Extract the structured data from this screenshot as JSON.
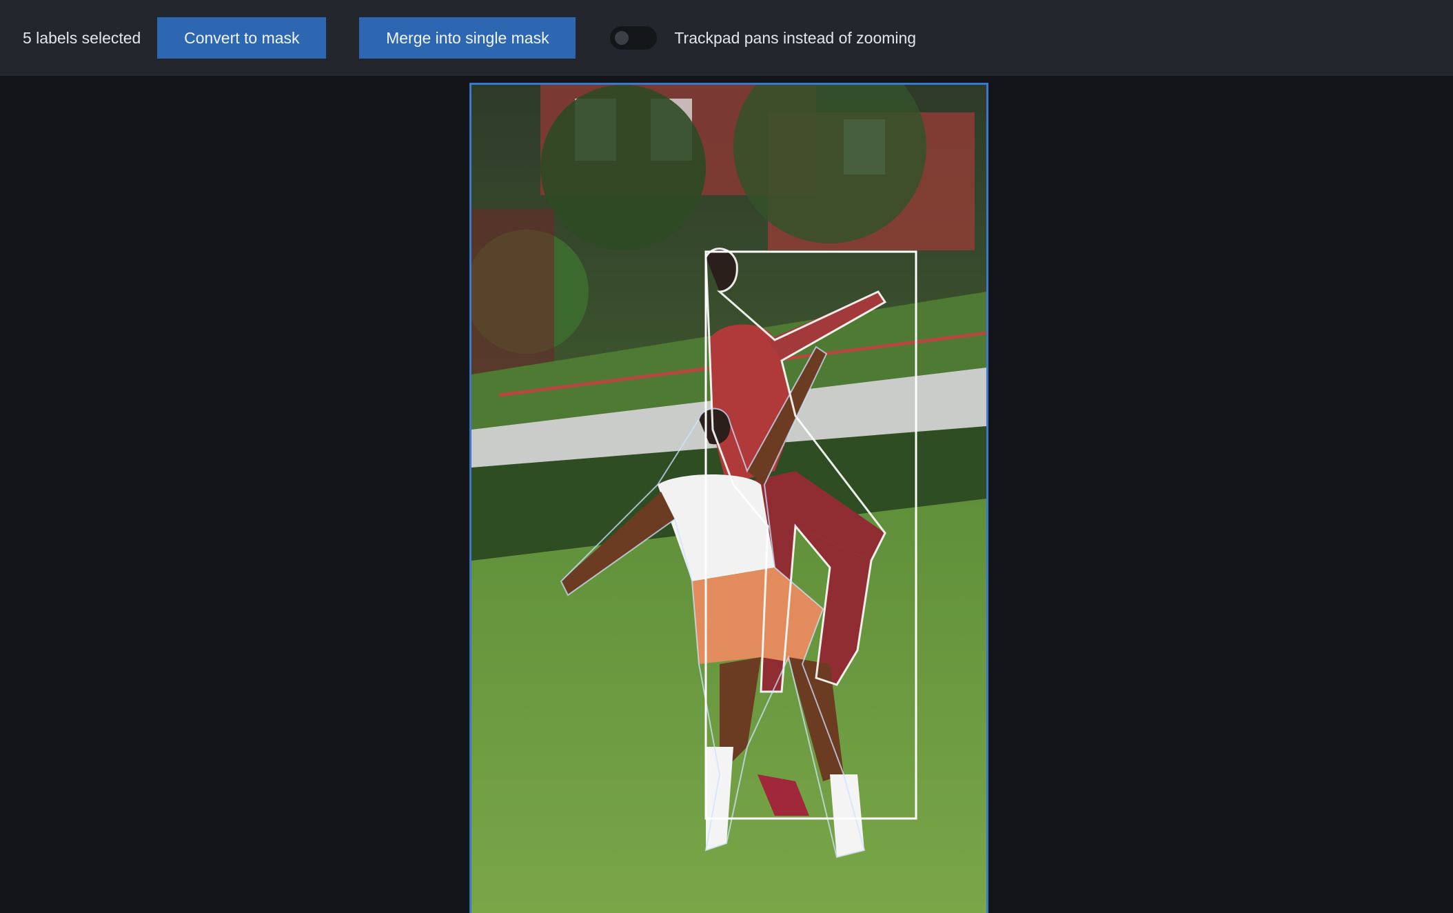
{
  "toolbar": {
    "selected_text": "5 labels selected",
    "convert_label": "Convert to mask",
    "merge_label": "Merge into single mask",
    "toggle_label": "Trackpad pans instead of zooming",
    "toggle_on": false
  },
  "colors": {
    "toolbar_bg": "#23262c",
    "button_bg": "#2e67b1",
    "canvas_bg": "#121418",
    "frame_border": "#3c78c8"
  }
}
